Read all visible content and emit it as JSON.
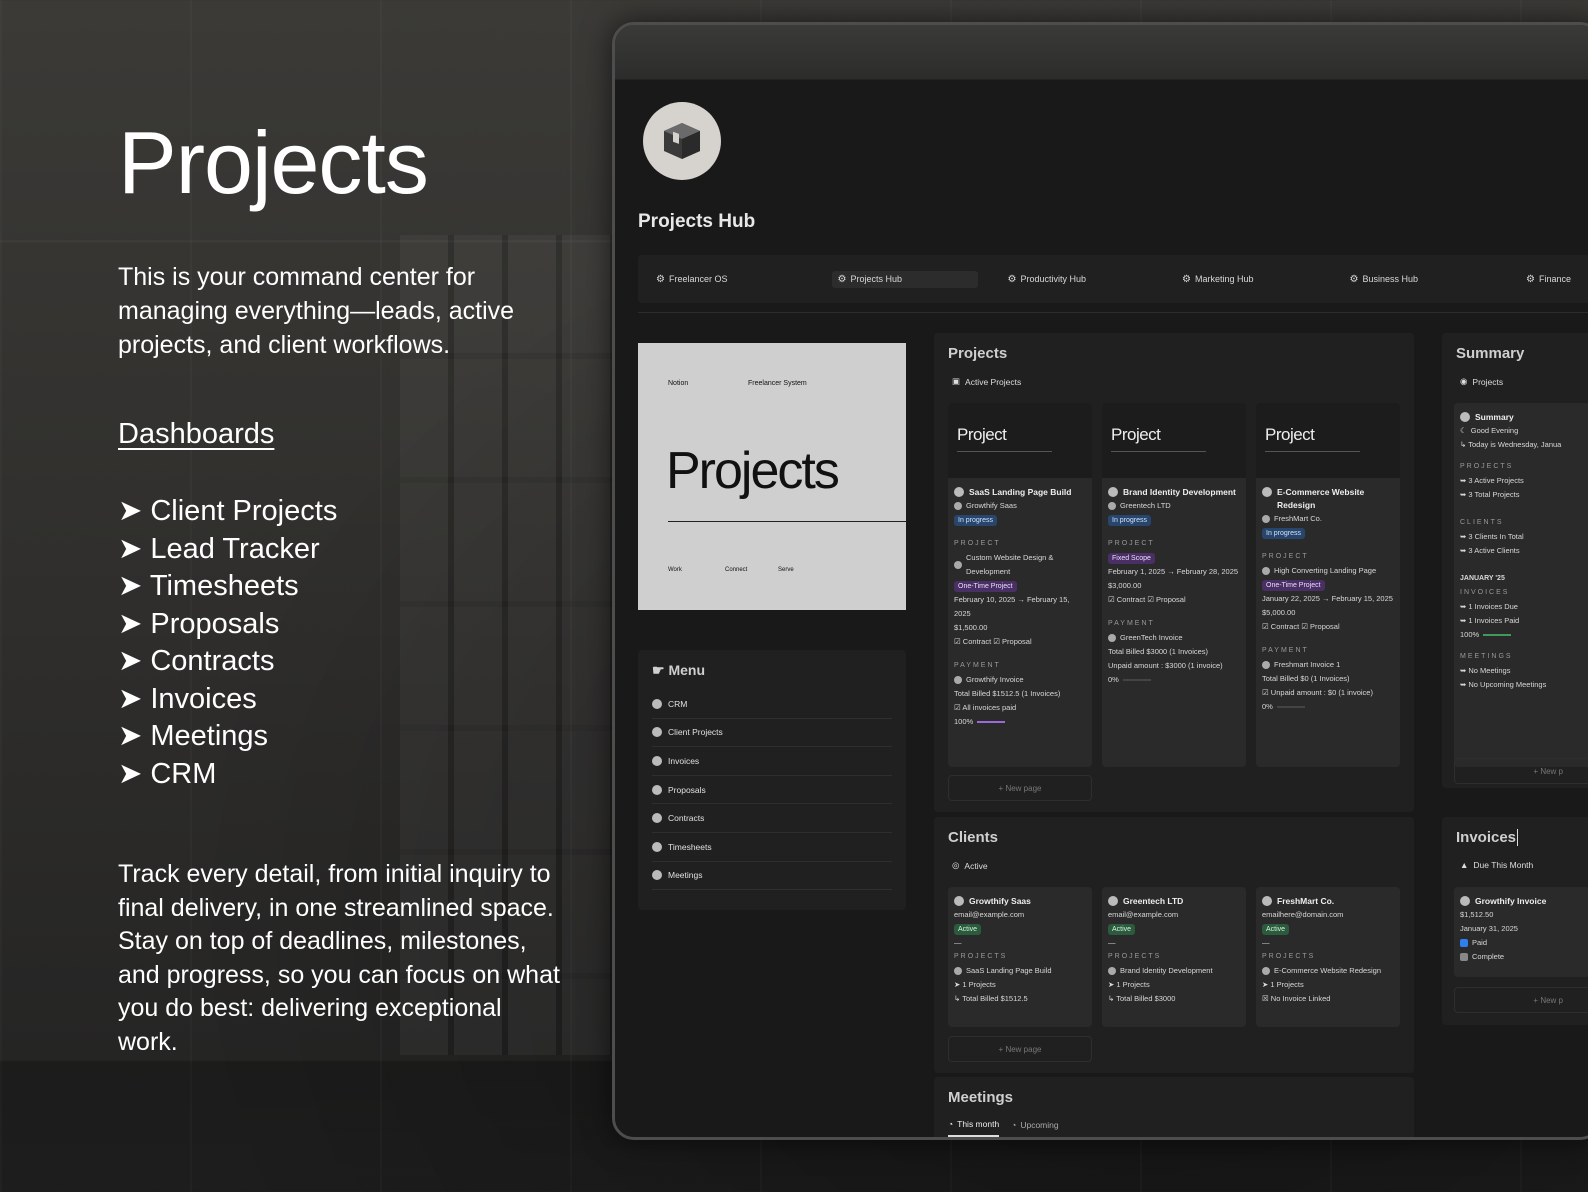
{
  "hero": {
    "title": "Projects",
    "intro": "This is your command center for managing everything—leads, active projects, and client workflows.",
    "dashboards_heading": "Dashboards",
    "dashboards": [
      "➤ Client Projects",
      "➤ Lead Tracker",
      "➤ Timesheets",
      "➤ Proposals",
      "➤ Contracts",
      "➤ Invoices",
      "➤ Meetings",
      "➤ CRM"
    ],
    "outro": "Track every detail, from initial inquiry to final delivery, in one streamlined space. Stay on top of deadlines, milestones, and progress, so you can focus on what you do best: delivering exceptional work."
  },
  "app": {
    "title": "Projects Hub",
    "logo_icon": "box-icon",
    "nav": [
      {
        "label": "Freelancer OS",
        "icon": "gear-icon"
      },
      {
        "label": "Projects Hub",
        "icon": "gear-icon",
        "active": true
      },
      {
        "label": "Productivity Hub",
        "icon": "gear-icon"
      },
      {
        "label": "Marketing Hub",
        "icon": "gear-icon"
      },
      {
        "label": "Business Hub",
        "icon": "gear-icon"
      },
      {
        "label": "Finance",
        "icon": "gear-icon"
      }
    ],
    "cover": {
      "top_left": "Notion",
      "top_mid": "Freelancer System",
      "title": "Projects",
      "bottom": [
        "Work",
        "Connect",
        "Serve"
      ]
    },
    "menu": {
      "heading": "Menu",
      "items": [
        "CRM",
        "Client Projects",
        "Invoices",
        "Proposals",
        "Contracts",
        "Timesheets",
        "Meetings"
      ]
    },
    "projects": {
      "heading": "Projects",
      "view": "Active Projects",
      "cover_label": "Project",
      "new_page": "New page",
      "cards": [
        {
          "title": "SaaS Landing Page Build",
          "client": "Growthify Saas",
          "status": "In progress",
          "section_project": "PROJECT",
          "project_name": "Custom Website Design & Development",
          "type": "One-Time Project",
          "dates": "February 10, 2025 → February 15, 2025",
          "amount": "$1,500.00",
          "docs": "☑ Contract ☑ Proposal",
          "section_payment": "PAYMENT",
          "invoice": "Growthify Invoice",
          "billed": "Total Billed $1512.5 (1 Invoices)",
          "unpaid": "☑ All invoices paid",
          "progress": "100%"
        },
        {
          "title": "Brand Identity Development",
          "client": "Greentech LTD",
          "status": "In progress",
          "section_project": "PROJECT",
          "type": "Fixed Scope",
          "dates": "February 1, 2025 → February 28, 2025",
          "amount": "$3,000.00",
          "docs": "☑ Contract ☑ Proposal",
          "section_payment": "PAYMENT",
          "invoice": "GreenTech Invoice",
          "billed": "Total Billed $3000 (1 Invoices)",
          "unpaid": "Unpaid amount : $3000 (1 invoice)",
          "progress": "0%"
        },
        {
          "title": "E-Commerce Website Redesign",
          "client": "FreshMart Co.",
          "status": "In progress",
          "section_project": "PROJECT",
          "project_name": "High Converting Landing Page",
          "type": "One-Time Project",
          "dates": "January 22, 2025 → February 15, 2025",
          "amount": "$5,000.00",
          "docs": "☑ Contract ☑ Proposal",
          "section_payment": "PAYMENT",
          "invoice": "Freshmart Invoice 1",
          "billed": "Total Billed $0 (1 Invoices)",
          "unpaid": "☑ Unpaid amount : $0 (1 invoice)",
          "progress": "0%"
        }
      ]
    },
    "summary": {
      "heading": "Summary",
      "view": "Projects",
      "card_title": "Summary",
      "greeting": "Good Evening",
      "today": "↳ Today is Wednesday, Janua",
      "projects_label": "PROJECTS",
      "projects_lines": [
        "➥ 3 Active Projects",
        "➥ 3 Total Projects"
      ],
      "clients_label": "CLIENTS",
      "clients_lines": [
        "➥ 3 Clients In Total",
        "➥ 3 Active Clients"
      ],
      "month_label": "JANUARY '25",
      "invoices_label": "INVOICES",
      "invoice_lines": [
        "➥ 1 Invoices Due",
        "➥ 1 Invoices Paid"
      ],
      "invoice_progress": "100%",
      "meetings_label": "MEETINGS",
      "meeting_lines": [
        "➥ No Meetings",
        "➥ No Upcoming Meetings"
      ],
      "new_page": "+ New p"
    },
    "clients": {
      "heading": "Clients",
      "view": "Active",
      "new_page": "New page",
      "cards": [
        {
          "name": "Growthify Saas",
          "email": "email@example.com",
          "status": "Active",
          "projects_label": "PROJECTS",
          "project": "SaaS Landing Page Build",
          "count": "➤ 1 Projects",
          "billed": "↳ Total Billed $1512.5"
        },
        {
          "name": "Greentech LTD",
          "email": "email@example.com",
          "status": "Active",
          "projects_label": "PROJECTS",
          "project": "Brand Identity Development",
          "count": "➤ 1 Projects",
          "billed": "↳ Total Billed $3000"
        },
        {
          "name": "FreshMart Co.",
          "email": "emailhere@domain.com",
          "status": "Active",
          "projects_label": "PROJECTS",
          "project": "E-Commerce Website Redesign",
          "count": "➤ 1 Projects",
          "billed": "☒ No Invoice Linked"
        }
      ]
    },
    "invoices": {
      "heading": "Invoices",
      "view": "Due This Month",
      "card_title": "Growthify Invoice",
      "amount": "$1,512.50",
      "date": "January 31, 2025",
      "paid": "Paid",
      "complete": "Complete",
      "new_page": "+ New p"
    },
    "meetings": {
      "heading": "Meetings",
      "tabs": [
        "This month",
        "Upcoming"
      ]
    },
    "colors": {
      "accent_blue": "#2f80ed",
      "purple": "#9a6ad6",
      "green": "#3f9a5f"
    }
  }
}
